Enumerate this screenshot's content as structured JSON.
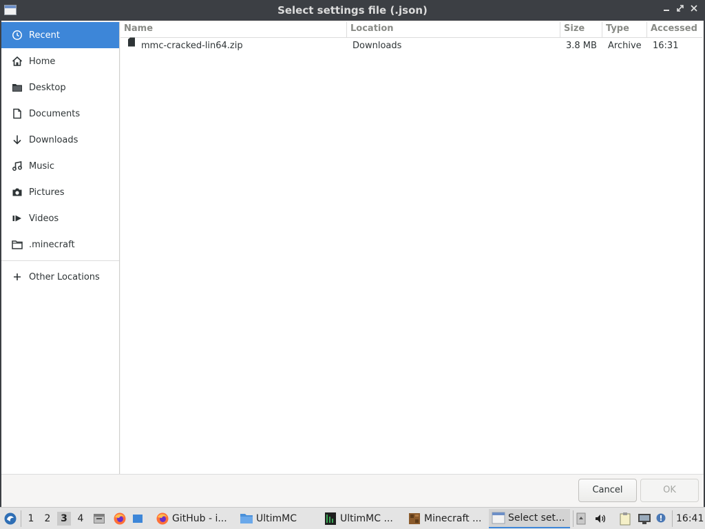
{
  "window": {
    "title": "Select settings file (.json)",
    "controls": {
      "minimize": "_",
      "maximize": "⤡",
      "close": "✕"
    }
  },
  "sidebar": {
    "items": [
      {
        "label": "Recent",
        "icon": "recent-icon",
        "active": true
      },
      {
        "label": "Home",
        "icon": "home-icon"
      },
      {
        "label": "Desktop",
        "icon": "folder-icon"
      },
      {
        "label": "Documents",
        "icon": "document-icon"
      },
      {
        "label": "Downloads",
        "icon": "download-arrow-icon"
      },
      {
        "label": "Music",
        "icon": "music-icon"
      },
      {
        "label": "Pictures",
        "icon": "camera-icon"
      },
      {
        "label": "Videos",
        "icon": "video-icon"
      },
      {
        "label": ".minecraft",
        "icon": "folder-icon"
      }
    ],
    "other_locations": {
      "label": "Other Locations",
      "icon": "plus-icon"
    }
  },
  "filelist": {
    "columns": [
      "Name",
      "Location",
      "Size",
      "Type",
      "Accessed"
    ],
    "rows": [
      {
        "name": "mmc-cracked-lin64.zip",
        "location": "Downloads",
        "size": "3.8 MB",
        "type": "Archive",
        "accessed": "16:31"
      }
    ]
  },
  "actions": {
    "cancel": "Cancel",
    "ok": "OK"
  },
  "taskbar": {
    "desktops": [
      "1",
      "2",
      "3",
      "4"
    ],
    "active_desktop": "3",
    "tasks": [
      {
        "label": "GitHub - i...",
        "icon": "firefox-icon"
      },
      {
        "label": "UltimMC",
        "icon": "folder-icon"
      },
      {
        "label": "UltimMC ...",
        "icon": "terminal-icon"
      },
      {
        "label": "Minecraft ...",
        "icon": "minecraft-icon"
      },
      {
        "label": "Select set...",
        "icon": "window-icon",
        "active": true
      }
    ],
    "clock": "16:41"
  },
  "colors": {
    "accent": "#3d86d8",
    "titlebar": "#3c3f44"
  }
}
